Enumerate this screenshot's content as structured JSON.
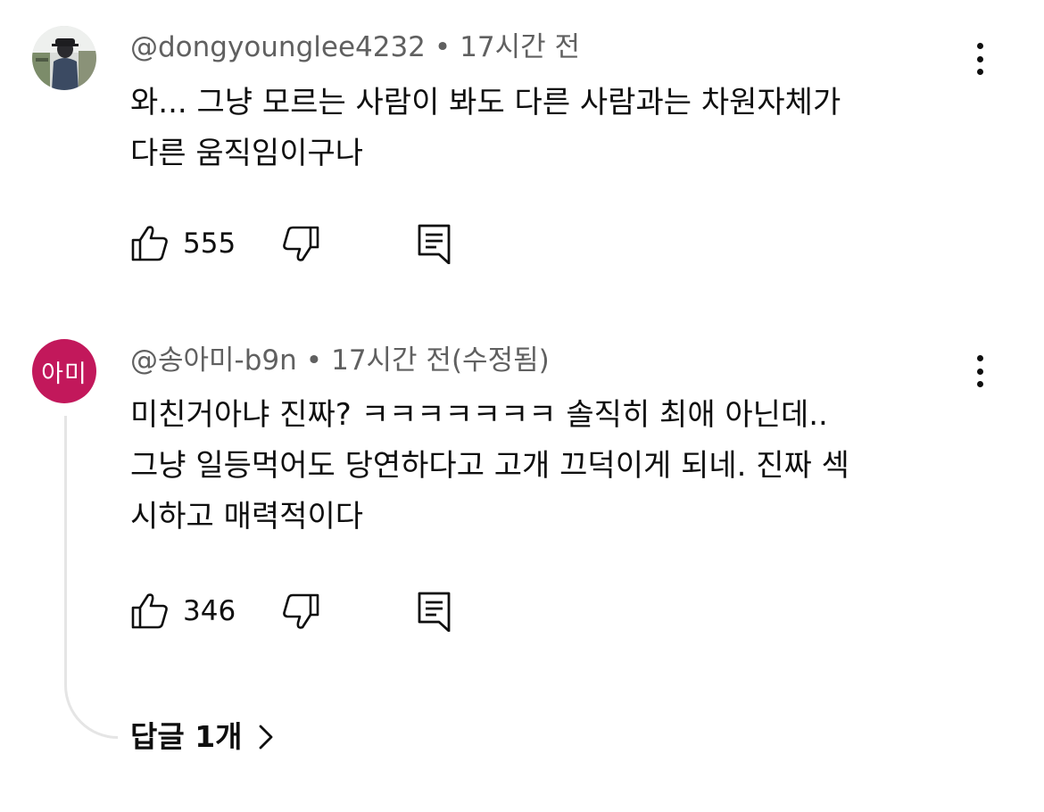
{
  "comments": [
    {
      "author": "@dongyounglee4232",
      "separator": "•",
      "time": "17시간 전",
      "lines": [
        "와... 그냥 모르는 사람이 봐도 다른 사람과는  차원자체가",
        "다른 움직임이구나"
      ],
      "likes": "555",
      "avatar_icon": "user-photo"
    },
    {
      "author": "@송아미-b9n",
      "separator": "•",
      "time": "17시간 전(수정됨)",
      "avatar_text": "아미",
      "avatar_color": "#c2185b",
      "lines": [
        "미친거아냐 진짜? ㅋㅋㅋㅋㅋㅋㅋ 솔직히 최애 아닌데..",
        "그냥 일등먹어도 당연하다고 고개 끄덕이게 되네. 진짜 섹",
        "시하고 매력적이다"
      ],
      "likes": "346"
    }
  ],
  "replies_label": "답글 1개",
  "icons": {
    "like": "thumbs-up-icon",
    "dislike": "thumbs-down-icon",
    "reply": "comment-icon",
    "more": "more-vertical-icon",
    "chevron": "chevron-right-icon"
  }
}
